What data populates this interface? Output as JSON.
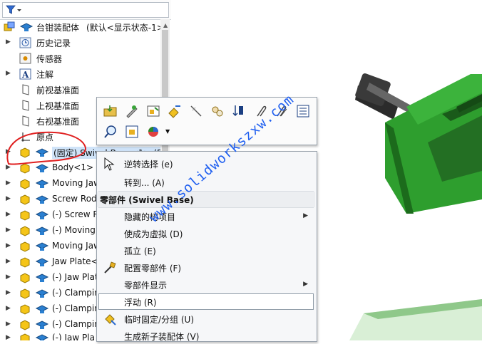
{
  "tree": {
    "root": {
      "name": "台钳装配体",
      "config": "(默认<显示状态-1>"
    },
    "items": [
      {
        "label": "历史记录",
        "icon": "history-icon"
      },
      {
        "label": "传感器",
        "icon": "sensor-icon"
      },
      {
        "label": "注解",
        "icon": "annotation-icon"
      },
      {
        "label": "前视基准面",
        "icon": "plane-icon"
      },
      {
        "label": "上视基准面",
        "icon": "plane-icon"
      },
      {
        "label": "右视基准面",
        "icon": "plane-icon"
      },
      {
        "label": "原点",
        "icon": "origin-icon"
      },
      {
        "label": "(固定) Swivel Base<1> (Dε",
        "icon": "part-icon"
      },
      {
        "label": "Body<1> (De",
        "icon": "part-icon"
      },
      {
        "label": "Moving Jaw",
        "icon": "part-icon"
      },
      {
        "label": "Screw Rod",
        "icon": "part-icon"
      },
      {
        "label": "(-) Screw R",
        "icon": "part-icon"
      },
      {
        "label": "(-) Moving",
        "icon": "part-icon"
      },
      {
        "label": "Moving Jaw",
        "icon": "part-icon"
      },
      {
        "label": "Jaw Plate<",
        "icon": "part-icon"
      },
      {
        "label": "(-) Jaw Plat",
        "icon": "part-icon"
      },
      {
        "label": "(-) Clampin",
        "icon": "part-icon"
      },
      {
        "label": "(-) Clampin",
        "icon": "part-icon"
      },
      {
        "label": "(-) Clampin",
        "icon": "part-icon"
      },
      {
        "label": "(-) Jaw Pla",
        "icon": "part-icon"
      }
    ]
  },
  "menu": {
    "header": "零部件 (Swivel Base)",
    "items": [
      {
        "label": "逆转选择 (e)",
        "icon": "cursor-icon"
      },
      {
        "label": "转到... (A)"
      },
      {
        "label": "隐藏的树项目",
        "submenu": true
      },
      {
        "label": "使成为虚拟 (D)"
      },
      {
        "label": "孤立 (E)"
      },
      {
        "label": "配置零部件 (F)",
        "icon": "configure-icon"
      },
      {
        "label": "零部件显示",
        "submenu": true
      },
      {
        "label": "浮动 (R)"
      },
      {
        "label": "临时固定/分组 (U)",
        "icon": "fix-group-icon"
      },
      {
        "label": "生成新子装配体 (V)"
      }
    ]
  },
  "watermark": "www.solidworkszxw.com",
  "colors": {
    "green": "#2e9e2e",
    "green_dark": "#1c6b1c",
    "annotation_red": "#e02020",
    "watermark_blue": "#1f5ff0"
  }
}
